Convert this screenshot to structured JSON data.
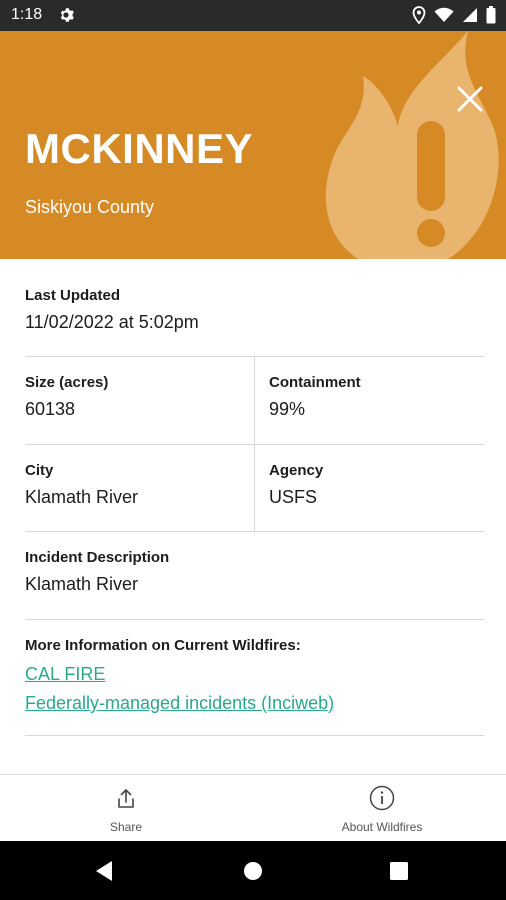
{
  "status_bar": {
    "time": "1:18"
  },
  "header": {
    "title": "MCKINNEY",
    "county": "Siskiyou County",
    "colors": {
      "background": "#d58a25",
      "flame": "#e9b46e"
    }
  },
  "details": {
    "last_updated": {
      "label": "Last Updated",
      "value": "11/02/2022 at 5:02pm"
    },
    "size": {
      "label": "Size (acres)",
      "value": "60138"
    },
    "containment": {
      "label": "Containment",
      "value": "99%"
    },
    "city": {
      "label": "City",
      "value": "Klamath River"
    },
    "agency": {
      "label": "Agency",
      "value": "USFS"
    },
    "description": {
      "label": "Incident Description",
      "value": "Klamath River"
    }
  },
  "more_info": {
    "label": "More Information on Current Wildfires:",
    "links": [
      {
        "text": "CAL FIRE"
      },
      {
        "text": "Federally-managed incidents (Inciweb)"
      }
    ],
    "link_color": "#2aa88f"
  },
  "bottom_nav": {
    "share": {
      "label": "Share",
      "icon": "share-icon"
    },
    "about": {
      "label": "About Wildfires",
      "icon": "info-icon"
    }
  }
}
